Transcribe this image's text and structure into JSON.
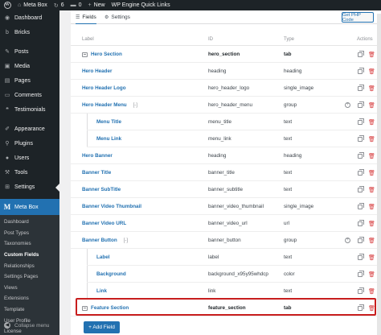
{
  "adminbar": {
    "wp_logo": "W",
    "site_name": "Meta Box",
    "updates_count": "6",
    "comments_count": "0",
    "new_label": "New",
    "quick_links": "WP Engine Quick Links"
  },
  "sidebar": {
    "items_top": [
      {
        "label": "Dashboard",
        "icon": "dashboard-icon",
        "glyph": "◉"
      },
      {
        "label": "Bricks",
        "icon": "bricks-icon",
        "glyph": "b"
      }
    ],
    "items_main": [
      {
        "label": "Posts",
        "icon": "pin-icon",
        "glyph": "✎"
      },
      {
        "label": "Media",
        "icon": "media-icon",
        "glyph": "▣"
      },
      {
        "label": "Pages",
        "icon": "pages-icon",
        "glyph": "▤"
      },
      {
        "label": "Comments",
        "icon": "comment-icon",
        "glyph": "▭"
      },
      {
        "label": "Testimonials",
        "icon": "testimonial-icon",
        "glyph": "❝"
      }
    ],
    "items_tools": [
      {
        "label": "Appearance",
        "icon": "brush-icon",
        "glyph": "✐"
      },
      {
        "label": "Plugins",
        "icon": "plugin-icon",
        "glyph": "⚲"
      },
      {
        "label": "Users",
        "icon": "users-icon",
        "glyph": "●"
      },
      {
        "label": "Tools",
        "icon": "wrench-icon",
        "glyph": "⚒"
      },
      {
        "label": "Settings",
        "icon": "settings-icon",
        "glyph": "⊞"
      }
    ],
    "current": {
      "label": "Meta Box",
      "icon": "metabox-icon",
      "glyph": "M"
    },
    "submenu": [
      "Dashboard",
      "Post Types",
      "Taxonomies",
      "Custom Fields",
      "Relationships",
      "Settings Pages",
      "Views",
      "Extensions",
      "Template",
      "User Profile",
      "License"
    ],
    "submenu_active": "Custom Fields",
    "collapse_label": "Collapse menu"
  },
  "tabs": {
    "fields": "Fields",
    "settings": "Settings"
  },
  "php_button": "Get PHP Code",
  "columns": {
    "label": "Label",
    "id": "ID",
    "type": "Type",
    "actions": "Actions"
  },
  "rows": [
    {
      "label": "Hero Section",
      "id": "hero_section",
      "type": "tab",
      "kind": "tab",
      "indent": 0
    },
    {
      "label": "Hero Header",
      "id": "heading",
      "type": "heading",
      "kind": "field",
      "indent": 0
    },
    {
      "label": "Hero Header Logo",
      "id": "hero_header_logo",
      "type": "single_image",
      "kind": "field",
      "indent": 0
    },
    {
      "label": "Hero Header Menu",
      "id": "hero_header_menu",
      "type": "group",
      "kind": "group",
      "indent": 0
    },
    {
      "label": "Menu Title",
      "id": "menu_title",
      "type": "text",
      "kind": "field",
      "indent": 1
    },
    {
      "label": "Menu Link",
      "id": "menu_link",
      "type": "text",
      "kind": "field",
      "indent": 1
    },
    {
      "label": "Hero Banner",
      "id": "heading",
      "type": "heading",
      "kind": "field",
      "indent": 0
    },
    {
      "label": "Banner Title",
      "id": "banner_title",
      "type": "text",
      "kind": "field",
      "indent": 0
    },
    {
      "label": "Banner SubTitle",
      "id": "banner_subtitle",
      "type": "text",
      "kind": "field",
      "indent": 0
    },
    {
      "label": "Banner Video Thumbnail",
      "id": "banner_video_thumbnail",
      "type": "single_image",
      "kind": "field",
      "indent": 0
    },
    {
      "label": "Banner Video URL",
      "id": "banner_video_url",
      "type": "url",
      "kind": "field",
      "indent": 0
    },
    {
      "label": "Banner Button",
      "id": "banner_button",
      "type": "group",
      "kind": "group",
      "indent": 0
    },
    {
      "label": "Label",
      "id": "label",
      "type": "text",
      "kind": "field",
      "indent": 1
    },
    {
      "label": "Background",
      "id": "background_x95y95whdcp",
      "type": "color",
      "kind": "field",
      "indent": 1
    },
    {
      "label": "Link",
      "id": "link",
      "type": "text",
      "kind": "field",
      "indent": 1
    },
    {
      "label": "Feature Section",
      "id": "feature_section",
      "type": "tab",
      "kind": "tab",
      "indent": 0
    }
  ],
  "group_toggle": "[-]",
  "add_field_label": "+ Add Field"
}
